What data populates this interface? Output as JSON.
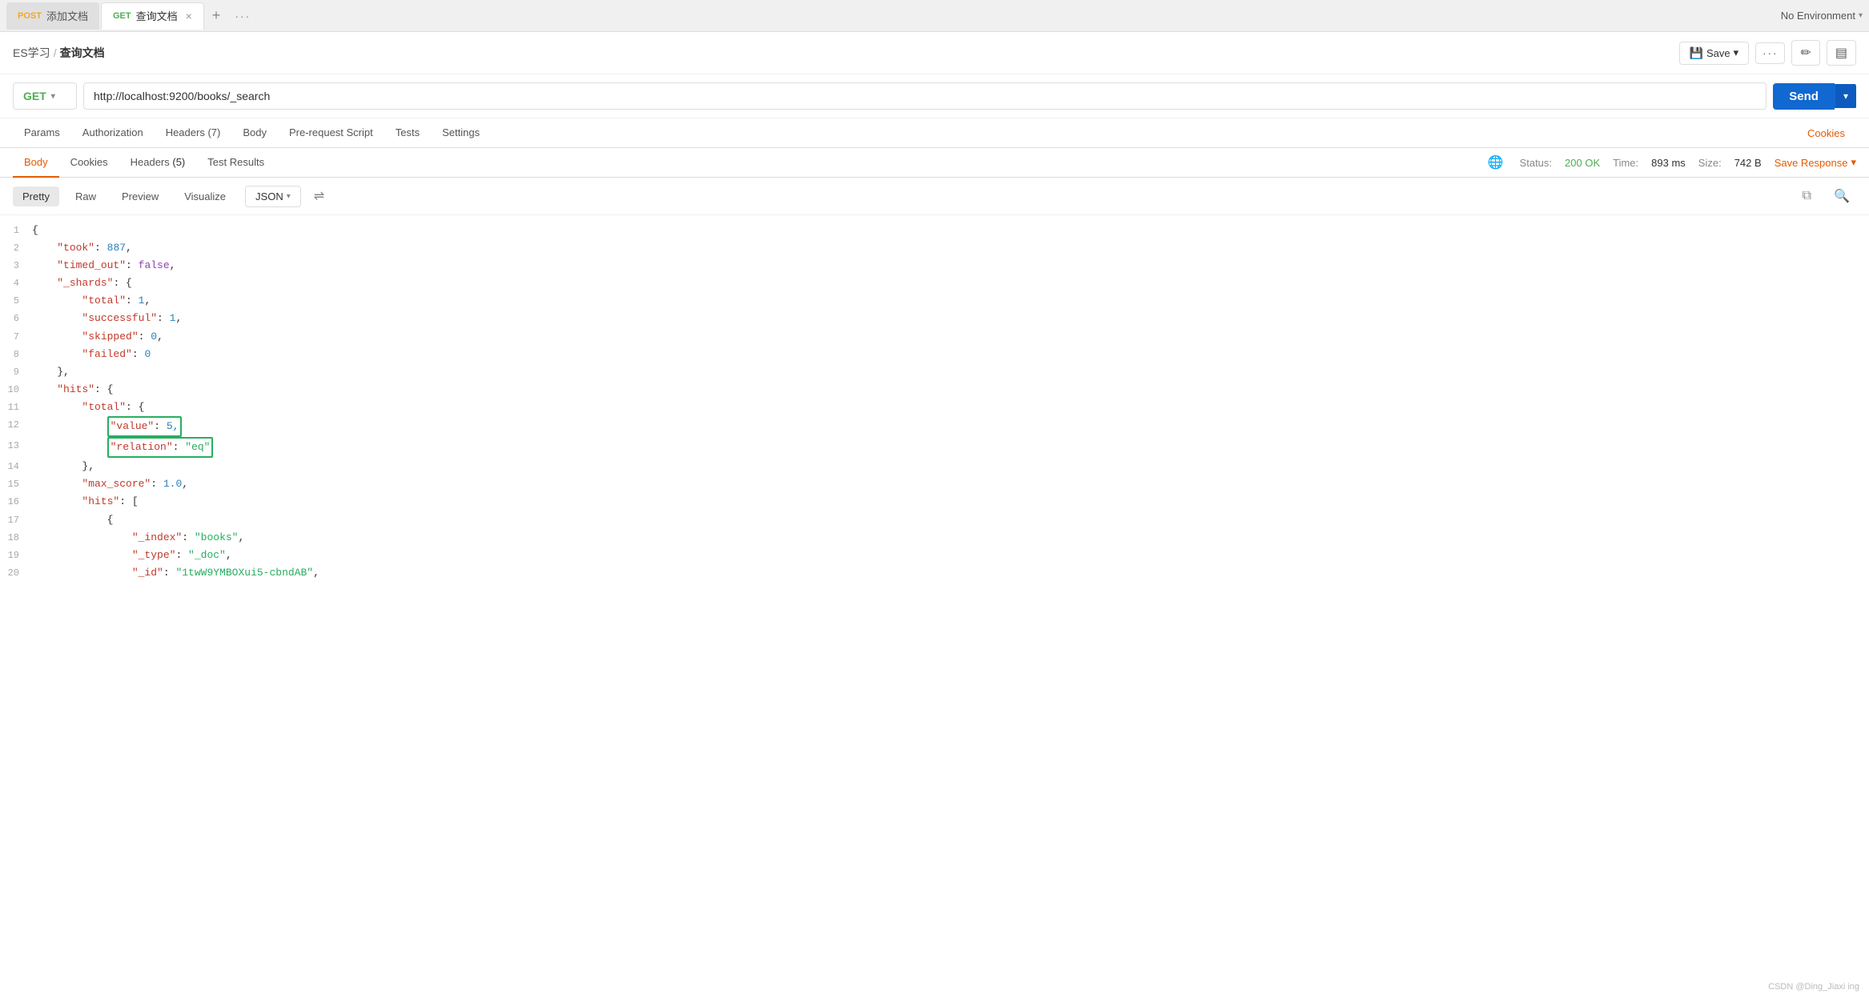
{
  "tabBar": {
    "tabs": [
      {
        "id": "tab-post",
        "method": "POST",
        "label": "添加文档",
        "active": false,
        "closeable": false
      },
      {
        "id": "tab-get",
        "method": "GET",
        "label": "查询文档",
        "active": true,
        "closeable": true
      }
    ],
    "addLabel": "+",
    "moreLabel": "···",
    "envLabel": "No Environment",
    "envChevron": "▾"
  },
  "breadcrumb": {
    "parent": "ES学习",
    "separator": "/",
    "current": "查询文档"
  },
  "toolbar": {
    "saveLabel": "Save",
    "moreLabel": "···",
    "editIcon": "✏",
    "infoIcon": "▤"
  },
  "urlBar": {
    "method": "GET",
    "methodChevron": "▾",
    "url": "http://localhost:9200/books/_search",
    "sendLabel": "Send",
    "sendChevron": "▾"
  },
  "requestTabs": {
    "tabs": [
      {
        "id": "params",
        "label": "Params"
      },
      {
        "id": "authorization",
        "label": "Authorization"
      },
      {
        "id": "headers",
        "label": "Headers",
        "count": "(7)"
      },
      {
        "id": "body",
        "label": "Body"
      },
      {
        "id": "prerequest",
        "label": "Pre-request Script"
      },
      {
        "id": "tests",
        "label": "Tests"
      },
      {
        "id": "settings",
        "label": "Settings"
      }
    ],
    "cookiesLabel": "Cookies"
  },
  "responseTabs": {
    "tabs": [
      {
        "id": "body",
        "label": "Body",
        "active": true
      },
      {
        "id": "cookies",
        "label": "Cookies"
      },
      {
        "id": "headers",
        "label": "Headers",
        "count": "(5)"
      },
      {
        "id": "testresults",
        "label": "Test Results"
      }
    ],
    "globeIcon": "🌐",
    "status": "200 OK",
    "time": "893 ms",
    "size": "742 B",
    "saveResponseLabel": "Save Response",
    "saveResponseChevron": "▾"
  },
  "formatBar": {
    "buttons": [
      {
        "id": "pretty",
        "label": "Pretty",
        "active": true
      },
      {
        "id": "raw",
        "label": "Raw",
        "active": false
      },
      {
        "id": "preview",
        "label": "Preview",
        "active": false
      },
      {
        "id": "visualize",
        "label": "Visualize",
        "active": false
      }
    ],
    "formatDropdown": "JSON",
    "formatChevron": "▾",
    "wrapIcon": "⇌",
    "copyIcon": "⧉",
    "searchIcon": "🔍"
  },
  "jsonLines": [
    {
      "num": 1,
      "content": "{",
      "type": "plain"
    },
    {
      "num": 2,
      "content": "    \"took\": 887,",
      "type": "key-num",
      "key": "took",
      "value": "887"
    },
    {
      "num": 3,
      "content": "    \"timed_out\": false,",
      "type": "key-bool",
      "key": "timed_out",
      "value": "false"
    },
    {
      "num": 4,
      "content": "    \"_shards\": {",
      "type": "key-obj",
      "key": "_shards"
    },
    {
      "num": 5,
      "content": "        \"total\": 1,",
      "type": "key-num",
      "key": "total",
      "value": "1"
    },
    {
      "num": 6,
      "content": "        \"successful\": 1,",
      "type": "key-num",
      "key": "successful",
      "value": "1"
    },
    {
      "num": 7,
      "content": "        \"skipped\": 0,",
      "type": "key-num",
      "key": "skipped",
      "value": "0"
    },
    {
      "num": 8,
      "content": "        \"failed\": 0",
      "type": "key-num",
      "key": "failed",
      "value": "0"
    },
    {
      "num": 9,
      "content": "    },",
      "type": "plain"
    },
    {
      "num": 10,
      "content": "    \"hits\": {",
      "type": "key-obj",
      "key": "hits"
    },
    {
      "num": 11,
      "content": "        \"total\": {",
      "type": "key-obj",
      "key": "total"
    },
    {
      "num": 12,
      "content": "            \"value\": 5,",
      "type": "key-num",
      "key": "value",
      "value": "5",
      "highlight": true
    },
    {
      "num": 13,
      "content": "            \"relation\": \"eq\"",
      "type": "key-str",
      "key": "relation",
      "value": "eq",
      "highlight": true
    },
    {
      "num": 14,
      "content": "        },",
      "type": "plain"
    },
    {
      "num": 15,
      "content": "        \"max_score\": 1.0,",
      "type": "key-num",
      "key": "max_score",
      "value": "1.0"
    },
    {
      "num": 16,
      "content": "        \"hits\": [",
      "type": "key-arr",
      "key": "hits"
    },
    {
      "num": 17,
      "content": "            {",
      "type": "plain"
    },
    {
      "num": 18,
      "content": "                \"_index\": \"books\",",
      "type": "key-str",
      "key": "_index",
      "value": "books"
    },
    {
      "num": 19,
      "content": "                \"_type\": \"_doc\",",
      "type": "key-str",
      "key": "_type",
      "value": "_doc"
    },
    {
      "num": 20,
      "content": "                \"_id\": \"1twW9YMBOXui5-cbndAB\",",
      "type": "key-str",
      "key": "_id",
      "value": "1twW9YMBOXui5-cbndAB"
    }
  ],
  "watermark": "CSDN @Ding_Jiaxi ing"
}
